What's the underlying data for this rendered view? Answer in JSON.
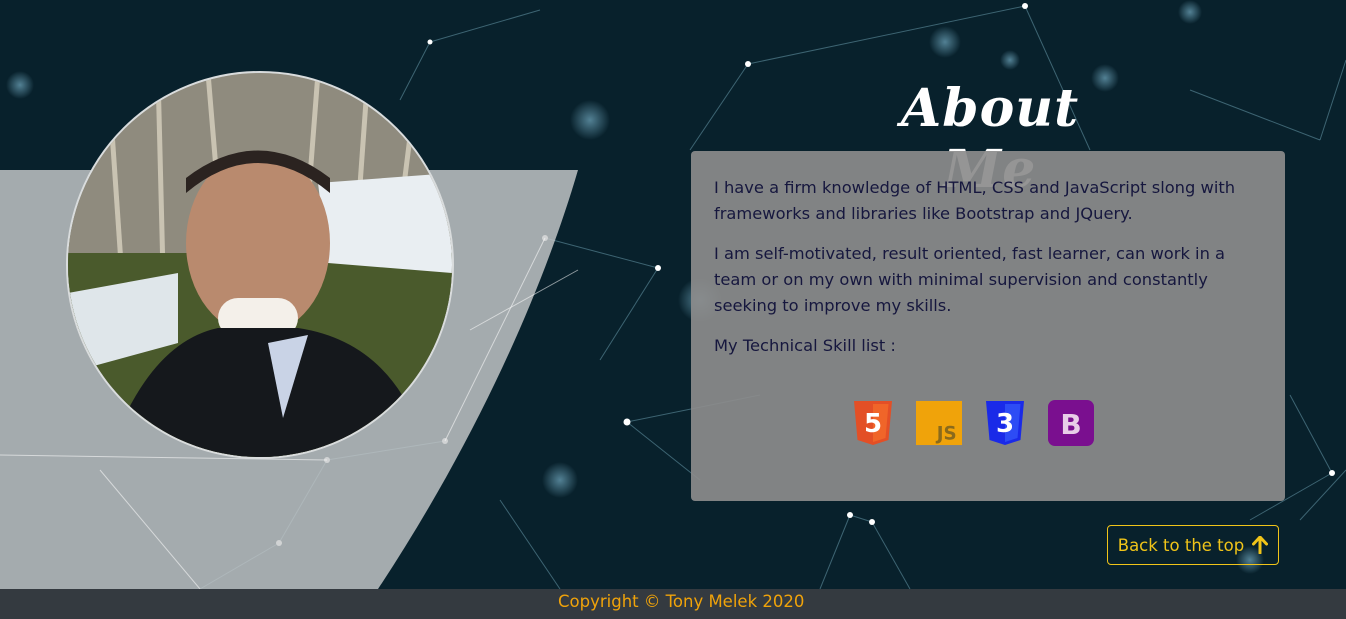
{
  "about": {
    "title": "About Me",
    "paragraph1": "I have a firm knowledge of HTML, CSS and JavaScript slong with frameworks and libraries like Bootstrap and JQuery.",
    "paragraph2": "I am self-motivated, result oriented, fast learner, can work in a team or on my own with minimal supervision and constantly seeking to improve my skills.",
    "skills_label": "My Technical Skill list :",
    "skills": [
      {
        "name": "html5-icon",
        "glyph": "5",
        "color": "#e34f26"
      },
      {
        "name": "javascript-icon",
        "glyph": "JS",
        "color": "#f0a30a"
      },
      {
        "name": "css3-icon",
        "glyph": "3",
        "color": "#1a2ae8"
      },
      {
        "name": "bootstrap-icon",
        "glyph": "B",
        "color": "#7a0f8f"
      }
    ]
  },
  "back_to_top": {
    "label": "Back to the top",
    "icon": "arrow-up-icon"
  },
  "footer": {
    "copyright": "Copyright © Tony Melek 2020"
  },
  "colors": {
    "accent": "#f0c419",
    "footer_bg": "#343a40",
    "copyright": "#f0a30a"
  }
}
